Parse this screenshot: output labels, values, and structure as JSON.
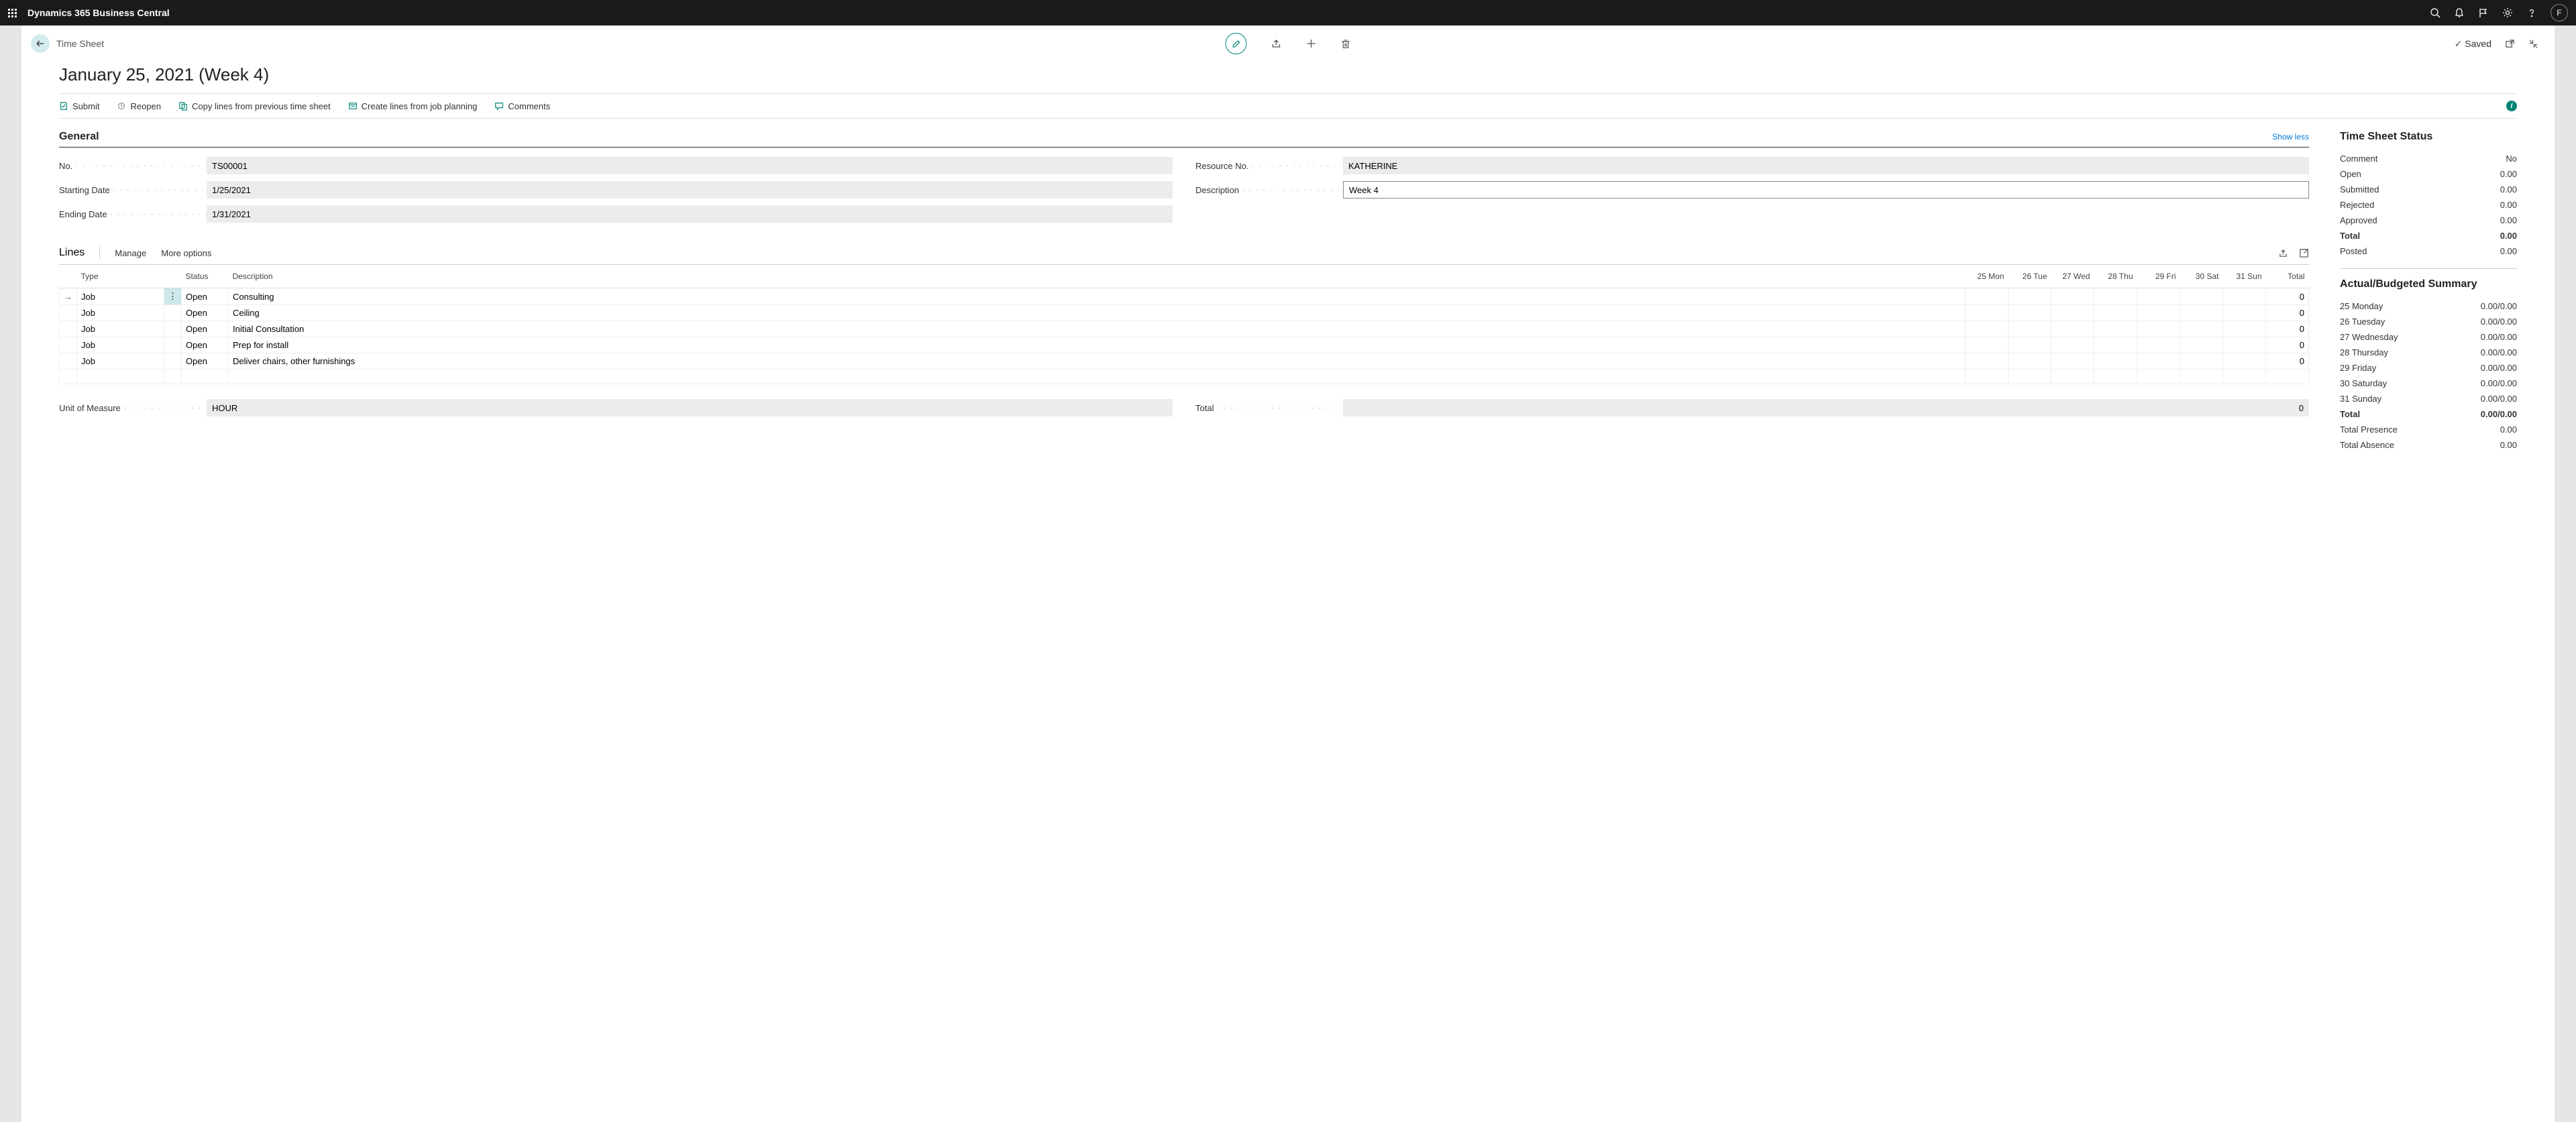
{
  "header": {
    "brand": "Dynamics 365 Business Central",
    "avatar": "F"
  },
  "crumb": {
    "label": "Time Sheet",
    "saved": "Saved"
  },
  "title": "January 25, 2021 (Week 4)",
  "actions": {
    "submit": "Submit",
    "reopen": "Reopen",
    "copy": "Copy lines from previous time sheet",
    "create": "Create lines from job planning",
    "comments": "Comments"
  },
  "general": {
    "heading": "General",
    "show_less": "Show less",
    "fields": {
      "no_label": "No.",
      "no_value": "TS00001",
      "starting_label": "Starting Date",
      "starting_value": "1/25/2021",
      "ending_label": "Ending Date",
      "ending_value": "1/31/2021",
      "resource_label": "Resource No.",
      "resource_value": "KATHERINE",
      "desc_label": "Description",
      "desc_value": "Week 4"
    }
  },
  "lines": {
    "heading": "Lines",
    "manage": "Manage",
    "more": "More options",
    "columns": {
      "type": "Type",
      "status": "Status",
      "description": "Description",
      "d1": "25 Mon",
      "d2": "26 Tue",
      "d3": "27 Wed",
      "d4": "28 Thu",
      "d5": "29 Fri",
      "d6": "30 Sat",
      "d7": "31 Sun",
      "total": "Total"
    },
    "rows": [
      {
        "type": "Job",
        "status": "Open",
        "desc": "Consulting",
        "total": "0"
      },
      {
        "type": "Job",
        "status": "Open",
        "desc": "Ceiling",
        "total": "0"
      },
      {
        "type": "Job",
        "status": "Open",
        "desc": "Initial Consultation",
        "total": "0"
      },
      {
        "type": "Job",
        "status": "Open",
        "desc": "Prep for install",
        "total": "0"
      },
      {
        "type": "Job",
        "status": "Open",
        "desc": "Deliver chairs, other furnishings",
        "total": "0"
      }
    ],
    "footer": {
      "uom_label": "Unit of Measure",
      "uom_value": "HOUR",
      "total_label": "Total",
      "total_value": "0"
    }
  },
  "status_box": {
    "title": "Time Sheet Status",
    "rows": [
      {
        "label": "Comment",
        "value": "No"
      },
      {
        "label": "Open",
        "value": "0.00"
      },
      {
        "label": "Submitted",
        "value": "0.00"
      },
      {
        "label": "Rejected",
        "value": "0.00"
      },
      {
        "label": "Approved",
        "value": "0.00"
      },
      {
        "label": "Total",
        "value": "0.00",
        "bold": true
      },
      {
        "label": "Posted",
        "value": "0.00"
      }
    ]
  },
  "summary_box": {
    "title": "Actual/Budgeted Summary",
    "rows": [
      {
        "label": "25 Monday",
        "value": "0.00/0.00"
      },
      {
        "label": "26 Tuesday",
        "value": "0.00/0.00"
      },
      {
        "label": "27 Wednesday",
        "value": "0.00/0.00"
      },
      {
        "label": "28 Thursday",
        "value": "0.00/0.00"
      },
      {
        "label": "29 Friday",
        "value": "0.00/0.00"
      },
      {
        "label": "30 Saturday",
        "value": "0.00/0.00"
      },
      {
        "label": "31 Sunday",
        "value": "0.00/0.00"
      },
      {
        "label": "Total",
        "value": "0.00/0.00",
        "bold": true
      },
      {
        "label": "Total Presence",
        "value": "0.00"
      },
      {
        "label": "Total Absence",
        "value": "0.00"
      }
    ]
  }
}
